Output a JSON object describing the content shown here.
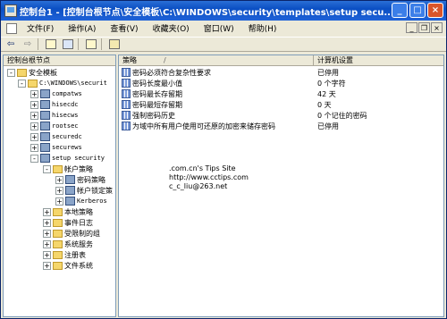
{
  "titlebar": {
    "title": "控制台1 - [控制台根节点\\安全模板\\C:\\WINDOWS\\security\\templates\\setup secu...",
    "minimize": "_",
    "maximize": "□",
    "close": "×"
  },
  "menubar": {
    "items": [
      "文件(F)",
      "操作(A)",
      "查看(V)",
      "收藏夹(O)",
      "窗口(W)",
      "帮助(H)"
    ],
    "mdi_minimize": "_",
    "mdi_restore": "❐",
    "mdi_close": "×"
  },
  "toolbar": {
    "back": "⇦",
    "forward": "⇨"
  },
  "tree": {
    "header": "控制台根节点",
    "nodes": [
      {
        "label": "安全模板",
        "expander": "-"
      },
      {
        "label": "C:\\WINDOWS\\securit",
        "expander": "-"
      },
      {
        "label": "compatws",
        "expander": "+"
      },
      {
        "label": "hisecdc",
        "expander": "+"
      },
      {
        "label": "hisecws",
        "expander": "+"
      },
      {
        "label": "rootsec",
        "expander": "+"
      },
      {
        "label": "securedc",
        "expander": "+"
      },
      {
        "label": "securews",
        "expander": "+"
      },
      {
        "label": "setup security",
        "expander": "-"
      },
      {
        "label": "帐户策略",
        "expander": "-"
      },
      {
        "label": "密码策略",
        "expander": "+"
      },
      {
        "label": "帐户锁定策",
        "expander": "+"
      },
      {
        "label": "Kerberos",
        "expander": "+"
      },
      {
        "label": "本地策略",
        "expander": "+"
      },
      {
        "label": "事件日志",
        "expander": "+"
      },
      {
        "label": "受限制的组",
        "expander": "+"
      },
      {
        "label": "系统服务",
        "expander": "+"
      },
      {
        "label": "注册表",
        "expander": "+"
      },
      {
        "label": "文件系统",
        "expander": "+"
      }
    ]
  },
  "list": {
    "col_policy": "策略",
    "sort_indicator": "/",
    "col_setting": "计算机设置",
    "rows": [
      {
        "policy": "密码必须符合复杂性要求",
        "value": "已停用"
      },
      {
        "policy": "密码长度最小值",
        "value": "0 个字符"
      },
      {
        "policy": "密码最长存留期",
        "value": "42 天"
      },
      {
        "policy": "密码最短存留期",
        "value": "0 天"
      },
      {
        "policy": "强制密码历史",
        "value": "0 个记住的密码"
      },
      {
        "policy": "为域中所有用户使用可还原的加密来储存密码",
        "value": "已停用"
      }
    ]
  },
  "watermark": {
    "line1": ".com.cn's Tips Site",
    "line2": "http://www.cctips.com",
    "line3": "c_c_liu@263.net"
  }
}
